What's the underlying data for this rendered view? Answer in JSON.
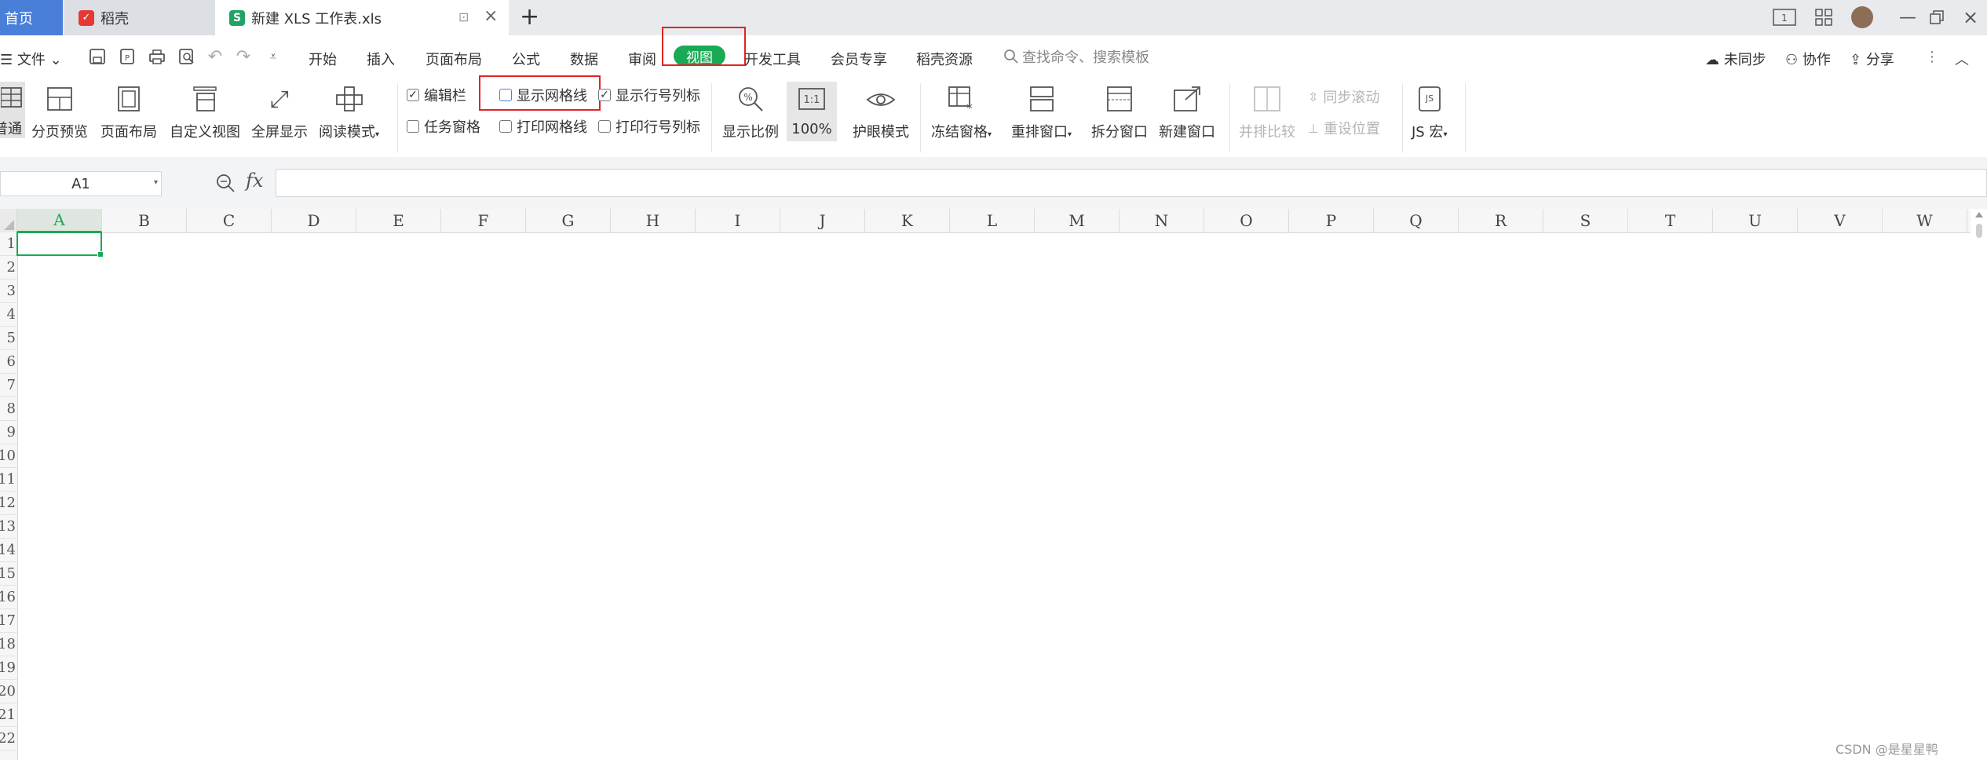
{
  "tabs": {
    "home": "首页",
    "daoke": "稻壳",
    "file": "新建 XLS 工作表.xls"
  },
  "quick": {
    "file_menu": "文件"
  },
  "menu": [
    "开始",
    "插入",
    "页面布局",
    "公式",
    "数据",
    "审阅",
    "视图",
    "开发工具",
    "会员专享",
    "稻壳资源"
  ],
  "active_tab": "视图",
  "search": {
    "placeholder": "查找命令、搜索模板"
  },
  "right_actions": {
    "sync": "未同步",
    "collab": "协作",
    "share": "分享"
  },
  "ribbon": {
    "normal": "普通",
    "page_break": "分页预览",
    "page_layout": "页面布局",
    "custom_view": "自定义视图",
    "fullscreen": "全屏显示",
    "reading_mode": "阅读模式",
    "check_formula_bar": "编辑栏",
    "check_show_gridlines": "显示网格线",
    "check_show_headings": "显示行号列标",
    "check_task_pane": "任务窗格",
    "check_print_gridlines": "打印网格线",
    "check_print_headings": "打印行号列标",
    "zoom": "显示比例",
    "zoom_100": "100%",
    "zoom_100_icon": "1:1",
    "eye_mode": "护眼模式",
    "freeze": "冻结窗格",
    "arrange": "重排窗口",
    "split": "拆分窗口",
    "new_window": "新建窗口",
    "side_by_side": "并排比较",
    "sync_scroll": "同步滚动",
    "reset_pos": "重设位置",
    "js_macro": "JS 宏"
  },
  "checks": {
    "formula_bar": true,
    "show_gridlines": false,
    "show_headings": true,
    "task_pane": false,
    "print_gridlines": false,
    "print_headings": false
  },
  "formula": {
    "name_box": "A1",
    "fx": "fx",
    "value": ""
  },
  "columns": [
    "A",
    "B",
    "C",
    "D",
    "E",
    "F",
    "G",
    "H",
    "I",
    "J",
    "K",
    "L",
    "M",
    "N",
    "O",
    "P",
    "Q",
    "R",
    "S",
    "T",
    "U",
    "V",
    "W"
  ],
  "rows": [
    "1",
    "2",
    "3",
    "4",
    "5",
    "6",
    "7",
    "8",
    "9",
    "10",
    "11",
    "12",
    "13",
    "14",
    "15",
    "16",
    "17",
    "18",
    "19",
    "20",
    "21",
    "22"
  ],
  "selected_cell": "A1",
  "watermark": "CSDN @是星星鸭",
  "colors": {
    "accent": "#1aaa55",
    "highlight": "#e02424",
    "home_tab": "#4a7fd9"
  }
}
